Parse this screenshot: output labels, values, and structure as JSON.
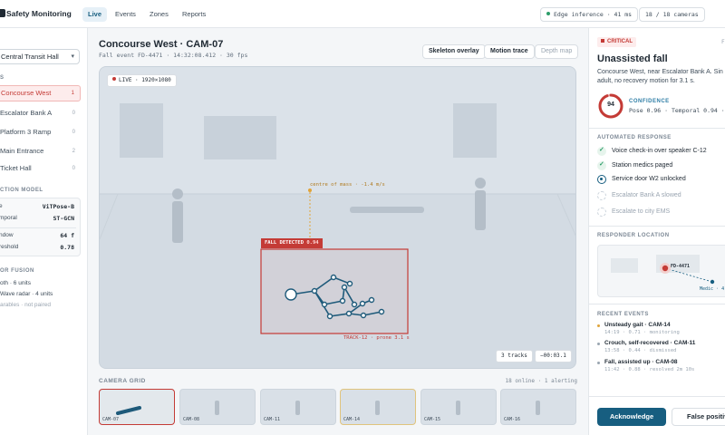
{
  "app": {
    "title": "Safety Monitoring"
  },
  "nav": {
    "tabs": [
      {
        "label": "Live",
        "active": true
      },
      {
        "label": "Events"
      },
      {
        "label": "Zones"
      },
      {
        "label": "Reports"
      }
    ]
  },
  "status": {
    "inference": "Edge inference · 41 ms",
    "cameras": "18 / 18 cameras"
  },
  "sidebar": {
    "site": "Central Transit Hall",
    "locations_label": "S",
    "locations": [
      {
        "label": "Concourse West",
        "count": "1",
        "active": true
      },
      {
        "label": "Escalator Bank A",
        "count": "0"
      },
      {
        "label": "Platform 3 Ramp",
        "count": "0"
      },
      {
        "label": "Main Entrance",
        "count": "2"
      },
      {
        "label": "Ticket Hall",
        "count": "0"
      }
    ],
    "model_label": "CTION MODEL",
    "model": [
      {
        "key": "e",
        "value": "ViTPose-B"
      },
      {
        "key": "mporal",
        "value": "ST-GCN"
      },
      {
        "key": "ndow",
        "value": "64 f"
      },
      {
        "key": "reshold",
        "value": "0.78"
      }
    ],
    "fusion_label": "OR FUSION",
    "fusion": [
      "oth · 6 units",
      "Wave radar · 4 units",
      "arables · not paired"
    ]
  },
  "main": {
    "camera_title": "Concourse West · CAM-07",
    "camera_sub": "Fall event FD-4471 · 14:32:08.412 · 30 fps",
    "buttons": {
      "skeleton": "Skeleton overlay",
      "motion": "Motion trace",
      "depth": "Depth map"
    },
    "live_badge": "LIVE · 1920×1080",
    "com_label": "centre of mass · -1.4 m/s",
    "detect_label": "FALL DETECTED",
    "detect_score": "0.94",
    "track_label": "TRACK-12 · prone 3.1 s",
    "tracks": "3 tracks",
    "elapsed": "−00:03.1",
    "grid_label": "CAMERA GRID",
    "grid_status": "18 online · 1 alerting",
    "thumbs": [
      "CAM-07",
      "CAM-08",
      "CAM-11",
      "CAM-14",
      "CAM-15",
      "CAM-16"
    ]
  },
  "alert": {
    "severity": "CRITICAL",
    "event_id": "FD",
    "title": "Unassisted fall",
    "desc_line1": "Concourse West, near Escalator Bank A. Sin",
    "desc_line2": "adult, no recovery motion for 3.1 s.",
    "confidence_value": "94",
    "confidence_fraction": 0.94,
    "confidence_label": "CONFIDENCE",
    "confidence_detail": "Pose 0.96 · Temporal 0.94 · Radar 0.",
    "response_label": "AUTOMATED RESPONSE",
    "steps": [
      {
        "label": "Voice check-in over speaker C-12",
        "state": "done"
      },
      {
        "label": "Station medics paged",
        "state": "done"
      },
      {
        "label": "Service door W2 unlocked",
        "state": "active"
      },
      {
        "label": "Escalator Bank A slowed",
        "state": "pending"
      },
      {
        "label": "Escalate to city EMS",
        "state": "pending"
      }
    ],
    "location_label": "RESPONDER LOCATION",
    "map_event": "FD-4471",
    "map_medic": "Medic · 4",
    "recent_label": "RECENT EVENTS",
    "recent": [
      {
        "title": "Unsteady gait · CAM-14",
        "meta": "14:19 · 0.71 · monitoring",
        "color": "#e0a43a"
      },
      {
        "title": "Crouch, self-recovered · CAM-11",
        "meta": "13:58 · 0.44 · dismissed",
        "color": "#9aa5b1"
      },
      {
        "title": "Fall, assisted up · CAM-08",
        "meta": "11:42 · 0.88 · resolved 2m 10s",
        "color": "#9aa5b1"
      }
    ],
    "acknowledge": "Acknowledge",
    "false_positive": "False positive"
  },
  "colors": {
    "accent": "#175e80",
    "critical": "#c43b36",
    "ok": "#2d9d6a"
  }
}
